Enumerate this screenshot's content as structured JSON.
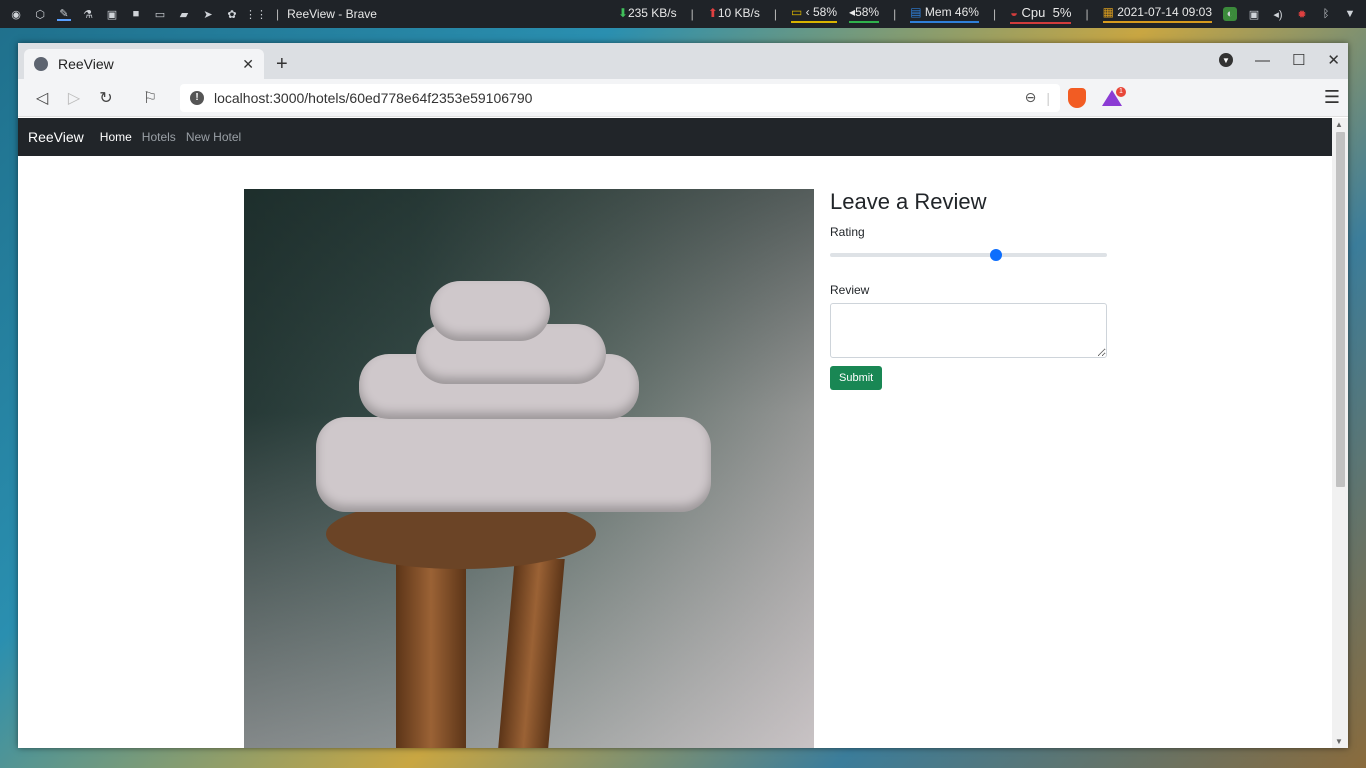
{
  "taskbar": {
    "window_title": "ReeView - Brave",
    "download_rate": "235 KB/s",
    "upload_rate": "10 KB/s",
    "battery": "58%",
    "volume": "58%",
    "memory": "Mem 46%",
    "cpu_label": "Cpu",
    "cpu_value": "5%",
    "datetime": "2021-07-14 09:03"
  },
  "browser": {
    "tab_title": "ReeView",
    "url": "localhost:3000/hotels/60ed778e64f2353e59106790",
    "rewards_badge": "1"
  },
  "site": {
    "brand": "ReeView",
    "nav": [
      "Home",
      "Hotels",
      "New Hotel"
    ]
  },
  "review_form": {
    "heading": "Leave a Review",
    "rating_label": "Rating",
    "rating_value": 3,
    "rating_max": 5,
    "review_label": "Review",
    "review_value": "",
    "submit_label": "Submit"
  },
  "colors": {
    "navbar_bg": "#212529",
    "submit_bg": "#198754",
    "slider_accent": "#0d6efd"
  }
}
